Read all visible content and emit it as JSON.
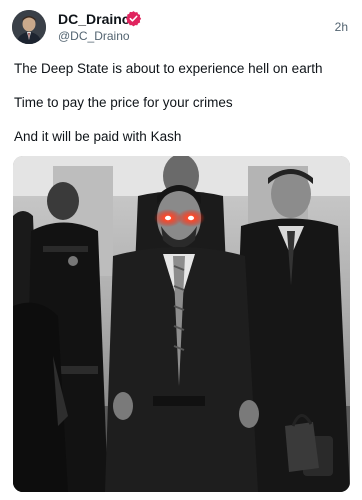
{
  "author": {
    "name": "DC_Draino",
    "handle": "@DC_Draino",
    "verified": true,
    "verified_color": "#e0245e"
  },
  "timestamp": "2h",
  "post": {
    "lines": [
      "The Deep State is about to experience hell on earth",
      "Time to pay the price for your crimes",
      "And it will be paid with Kash"
    ]
  },
  "media": {
    "type": "photo",
    "icon": "photo-image",
    "tone": "black-and-white",
    "accent_color": "#ff2a1a"
  }
}
